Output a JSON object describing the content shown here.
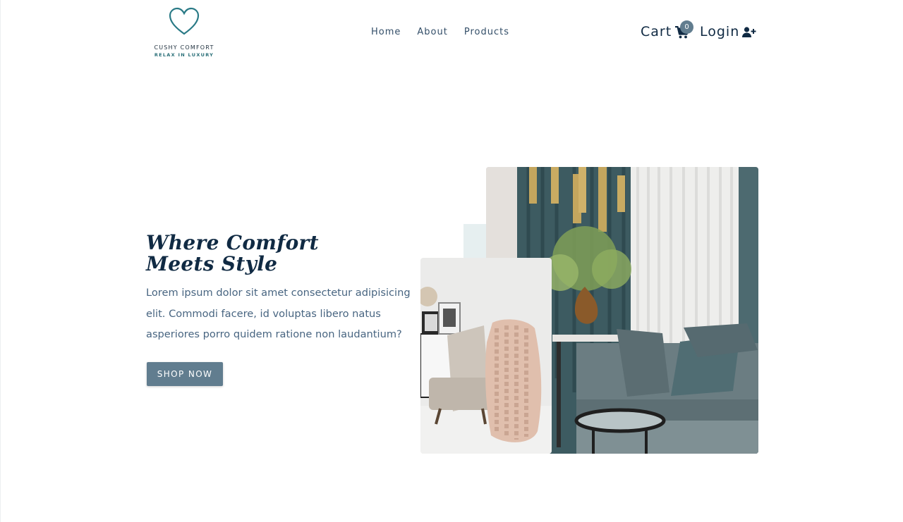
{
  "brand": {
    "name": "CUSHY COMFORT",
    "tagline": "RELAX IN LUXURY",
    "accent_color": "#2a7a86"
  },
  "nav": {
    "links": [
      "Home",
      "About",
      "Products"
    ],
    "cart_label": "Cart",
    "cart_count": "0",
    "login_label": "Login"
  },
  "icons": {
    "cart": "shopping-cart-icon",
    "login": "user-plus-icon",
    "logo": "heart-icon"
  },
  "hero": {
    "title_line1": "Where Comfort",
    "title_line2": "Meets Style",
    "text": "Lorem ipsum dolor sit amet consectetur adipisicing elit. Commodi facere, id voluptas libero natus asperiores porro quidem ratione non laudantium?",
    "button_label": "SHOP NOW",
    "button_color": "#617d8f"
  }
}
